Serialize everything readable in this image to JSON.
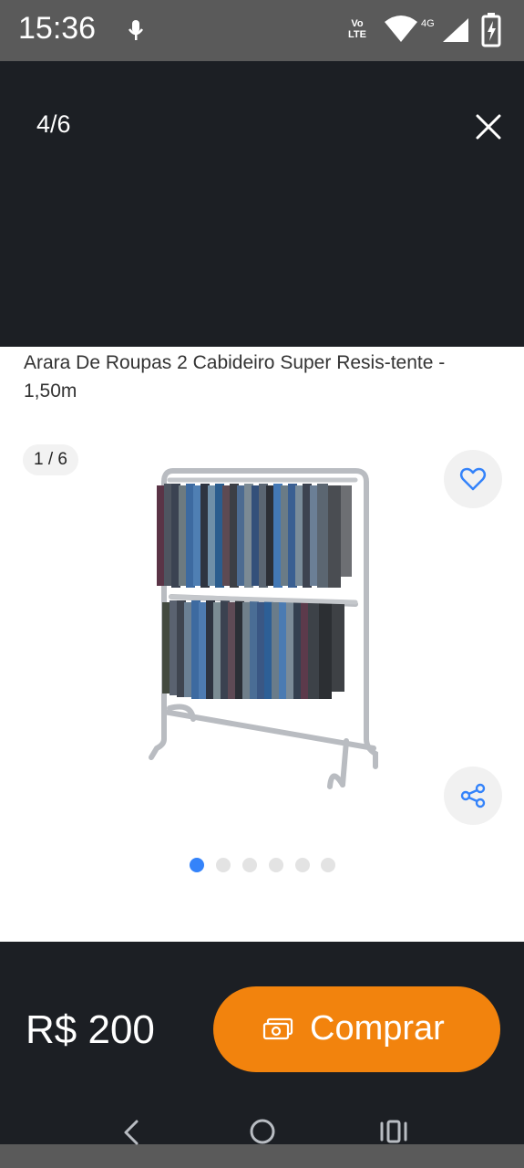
{
  "status_bar": {
    "time": "15:36",
    "volte_top": "Vo",
    "volte_bottom": "LTE",
    "network": "4G",
    "icons": [
      "mic-icon",
      "volte-icon",
      "wifi-icon",
      "signal-icon",
      "battery-icon"
    ]
  },
  "viewer": {
    "counter": "4/6",
    "close_icon": "close-icon"
  },
  "product": {
    "title": "Arara De Roupas 2 Cabideiro Super Resis-tente - 1,50m",
    "image_badge": "1 / 6",
    "image_count": 6,
    "active_image_index": 0,
    "favorite_icon": "heart-icon",
    "share_icon": "share-icon"
  },
  "purchase": {
    "price": "R$ 200",
    "buy_label": "Comprar",
    "buy_icon": "cash-icon"
  },
  "nav": {
    "icons": [
      "back-icon",
      "home-icon",
      "recents-icon"
    ]
  },
  "colors": {
    "dark_bg": "#1c1f24",
    "accent_orange": "#f2830d",
    "active_dot": "#3483fa",
    "status_bar": "#5a5a5a"
  }
}
